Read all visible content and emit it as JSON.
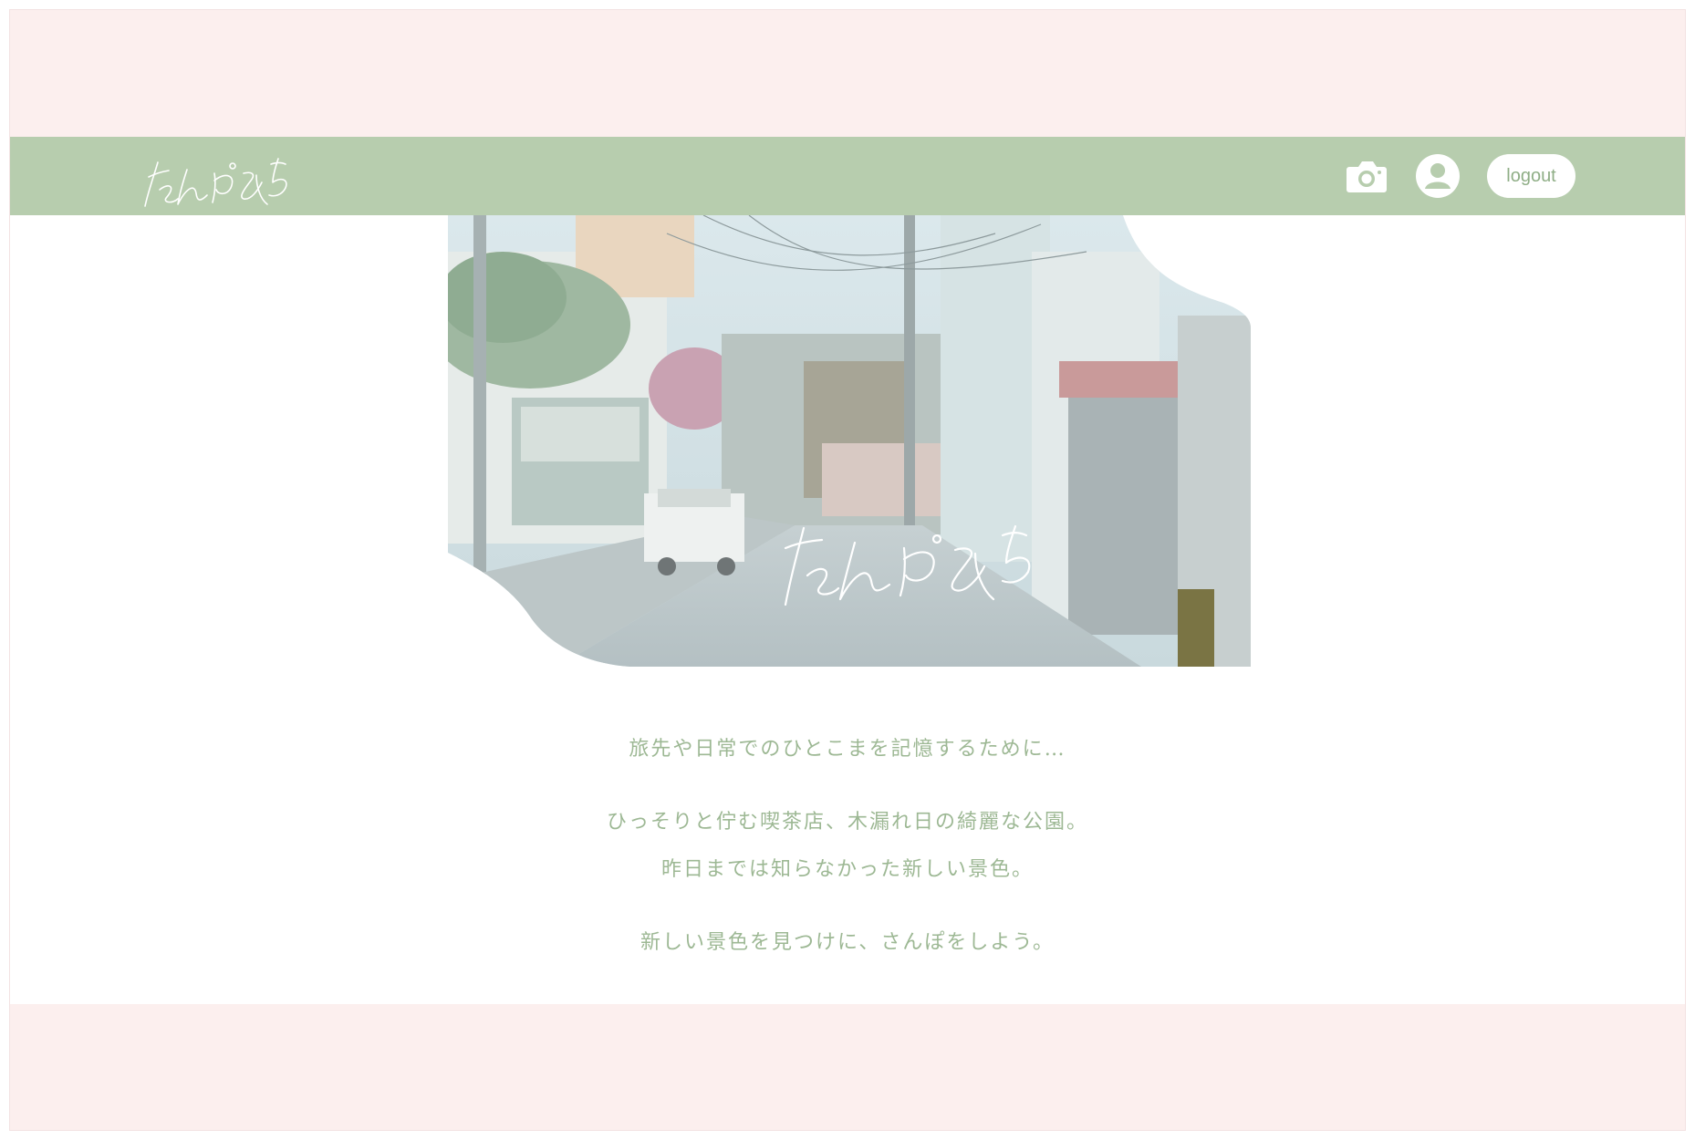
{
  "header": {
    "brand_text": "さんぽみち",
    "brand_icon": "handwritten-logo",
    "nav": {
      "camera_icon": "camera-icon",
      "user_icon": "user-icon",
      "logout_label": "logout"
    }
  },
  "hero": {
    "overlay_text": "さんぽみち",
    "image_description_icon": "street-photo"
  },
  "tagline": {
    "lines": [
      "旅先や日常でのひとこまを記憶するために…",
      "ひっそりと佇む喫茶店、木漏れ日の綺麗な公園。",
      "昨日までは知らなかった新しい景色。",
      "新しい景色を見つけに、さんぽをしよう。"
    ]
  },
  "colors": {
    "pink_band": "#fcefee",
    "navbar_green": "#b7cdae",
    "text_green": "#9db894",
    "white": "#ffffff"
  }
}
